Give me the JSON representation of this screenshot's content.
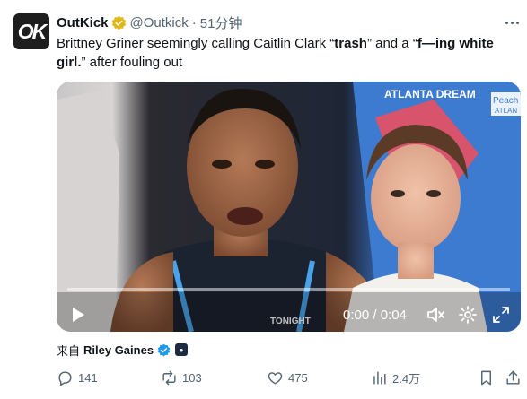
{
  "author": {
    "name": "OutKick",
    "handle": "@Outkick",
    "separator": "·",
    "time": "51分钟",
    "avatar_text": "OK",
    "verified_color": "#e2b719"
  },
  "tweet": {
    "text_parts": [
      "Brittney Griner seemingly calling Caitlin Clark “",
      "trash",
      "” and a “",
      "f—ing white girl.",
      "” after fouling out"
    ]
  },
  "video": {
    "time_display": "0:00 / 0:04",
    "banner_text": "TONIGHT",
    "sign_top": "ATLANTA DREAM",
    "sign_right_1": "Peach",
    "sign_right_2": "ATLAN",
    "progress": 0.0
  },
  "via": {
    "label": "来自",
    "name": "Riley Gaines",
    "verified_color": "#1d9bf0"
  },
  "actions": {
    "replies": "141",
    "reposts": "103",
    "likes": "475",
    "views": "2.4万"
  },
  "icons": [
    "verified-badge-icon",
    "more-icon",
    "play-icon",
    "mute-icon",
    "settings-icon",
    "fullscreen-icon",
    "reply-icon",
    "repost-icon",
    "like-icon",
    "views-icon",
    "bookmark-icon",
    "share-icon"
  ]
}
